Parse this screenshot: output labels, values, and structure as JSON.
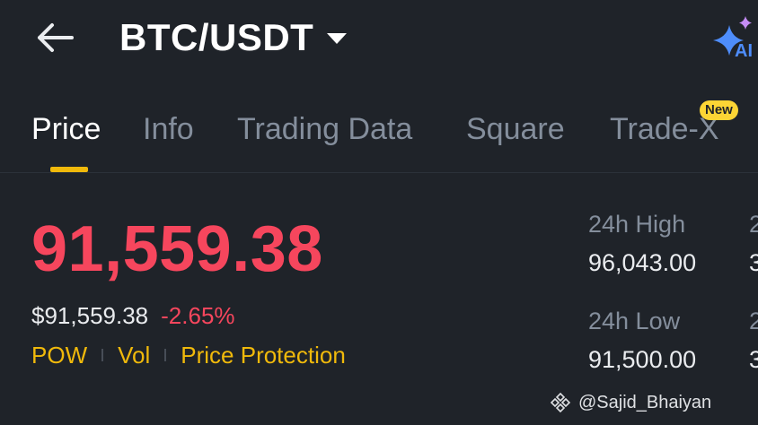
{
  "header": {
    "pair": "BTC/USDT",
    "ai_label": "AI"
  },
  "tabs": [
    {
      "label": "Price",
      "active": true
    },
    {
      "label": "Info",
      "active": false
    },
    {
      "label": "Trading Data",
      "active": false
    },
    {
      "label": "Square",
      "active": false
    },
    {
      "label": "Trade-X",
      "active": false
    }
  ],
  "new_badge": "New",
  "price": {
    "last": "91,559.38",
    "usd": "$91,559.38",
    "change_pct": "-2.65%"
  },
  "tags": [
    "POW",
    "Vol",
    "Price Protection"
  ],
  "stats": {
    "high_label": "24h High",
    "high_value": "96,043.00",
    "low_label": "24h Low",
    "low_value": "91,500.00",
    "col2_top_label_clip": "2",
    "col2_top_value_clip": "3",
    "col2_bottom_label_clip": "2",
    "col2_bottom_value_clip": "3"
  },
  "watermark": "@Sajid_Bhaiyan",
  "colors": {
    "background": "#1f2329",
    "down_red": "#f6465d",
    "accent_yellow": "#f0b90b",
    "muted_gray": "#848e9c"
  },
  "icons": {
    "back": "arrow-left-icon",
    "dropdown": "caret-down-icon",
    "ai": "sparkle-icon",
    "watermark_logo": "binance-diamond-icon"
  }
}
